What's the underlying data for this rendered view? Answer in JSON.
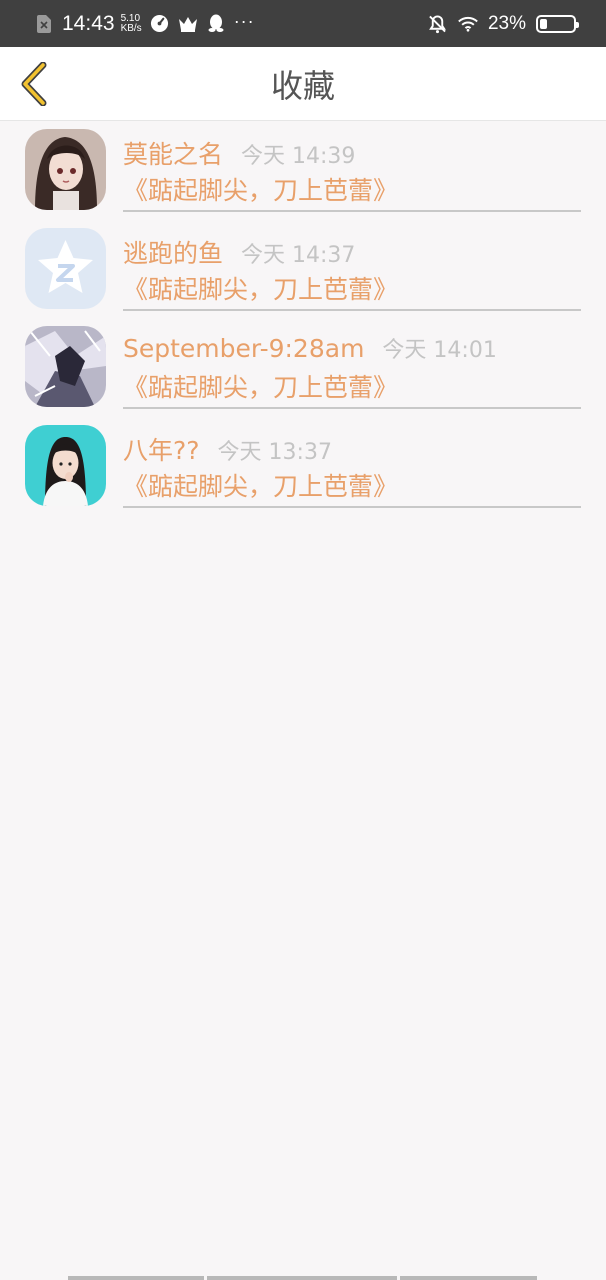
{
  "status_bar": {
    "time": "14:43",
    "speed_value": "5.10",
    "speed_unit": "KB/s",
    "dots": "···",
    "battery_percent": "23%",
    "battery_level": 0.23,
    "icons": [
      "sim-off-icon",
      "speedometer-icon",
      "crown-icon",
      "qq-penguin-icon",
      "bell-off-icon",
      "wifi-icon",
      "battery-icon"
    ]
  },
  "header": {
    "title": "收藏",
    "back_icon": "chevron-left-icon",
    "accent": "#f2c230"
  },
  "favorites": [
    {
      "name": "莫能之名",
      "time": "今天 14:39",
      "title": "《踮起脚尖，刀上芭蕾》"
    },
    {
      "name": "逃跑的鱼",
      "time": "今天 14:37",
      "title": "《踮起脚尖，刀上芭蕾》"
    },
    {
      "name": "September-9:28am",
      "time": "今天 14:01",
      "title": "《踮起脚尖，刀上芭蕾》"
    },
    {
      "name": "八年??",
      "time": "今天 13:37",
      "title": "《踮起脚尖，刀上芭蕾》"
    }
  ],
  "colors": {
    "name": "#e8a06a",
    "time": "#c4c4c4",
    "background": "#f8f6f7",
    "status_bar": "#404040"
  }
}
